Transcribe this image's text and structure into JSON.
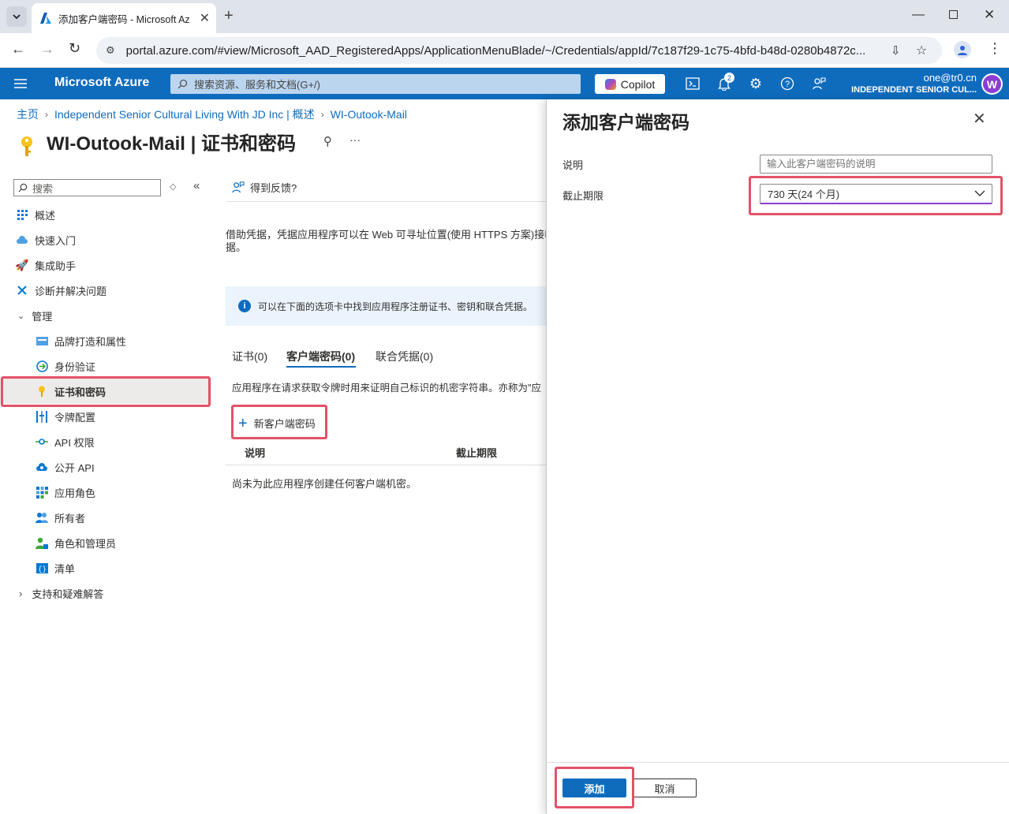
{
  "browser": {
    "tab_title": "添加客户端密码 - Microsoft Az",
    "url": "portal.azure.com/#view/Microsoft_AAD_RegisteredApps/ApplicationMenuBlade/~/Credentials/appId/7c187f29-1c75-4bfd-b48d-0280b4872c..."
  },
  "header": {
    "brand": "Microsoft Azure",
    "search_placeholder": "搜索资源、服务和文档(G+/)",
    "copilot": "Copilot",
    "notification_count": "2",
    "account_email": "one@tr0.cn",
    "account_tenant": "INDEPENDENT SENIOR CUL...",
    "avatar_letter": "W"
  },
  "breadcrumb": {
    "home": "主页",
    "tenant": "Independent Senior Cultural Living With JD Inc | 概述",
    "app": "WI-Outook-Mail"
  },
  "page": {
    "title": "WI-Outook-Mail | 证书和密码",
    "more": "···"
  },
  "sidebar": {
    "search_placeholder": "搜索",
    "items": {
      "overview": "概述",
      "quickstart": "快速入门",
      "integration": "集成助手",
      "diagnose": "诊断并解决问题",
      "manage": "管理",
      "branding": "品牌打造和属性",
      "auth": "身份验证",
      "certs": "证书和密码",
      "token": "令牌配置",
      "api_permissions": "API 权限",
      "expose_api": "公开 API",
      "app_roles": "应用角色",
      "owners": "所有者",
      "roles_admins": "角色和管理员",
      "manifest": "清单",
      "support": "支持和疑难解答"
    }
  },
  "main": {
    "feedback": "得到反馈?",
    "desc_line1": "借助凭据，凭据应用程序可以在 Web 可寻址位置(使用 HTTPS 方案)接收",
    "desc_line2": "据。",
    "info": "可以在下面的选项卡中找到应用程序注册证书、密钥和联合凭据。",
    "tabs": {
      "certs": "证书(0)",
      "secrets": "客户端密码(0)",
      "federated": "联合凭据(0)"
    },
    "secret_desc": "应用程序在请求获取令牌时用来证明自己标识的机密字符串。亦称为\"应",
    "new_secret": "新客户端密码",
    "col_desc": "说明",
    "col_expires": "截止期限",
    "empty": "尚未为此应用程序创建任何客户端机密。"
  },
  "panel": {
    "title": "添加客户端密码",
    "desc_label": "说明",
    "desc_placeholder": "输入此客户端密码的说明",
    "expires_label": "截止期限",
    "expires_value": "730 天(24 个月)",
    "add": "添加",
    "cancel": "取消"
  },
  "colors": {
    "azure_blue": "#0f6cbd",
    "highlight_red": "#e35268",
    "link": "#0f6cbd"
  }
}
